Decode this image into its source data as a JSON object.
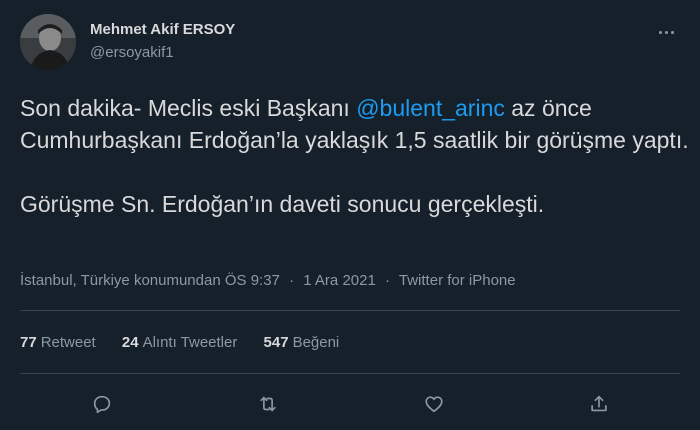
{
  "author": {
    "name": "Mehmet Akif ERSOY",
    "handle": "@ersoyakif1"
  },
  "tweet": {
    "text_part1": "Son dakika- Meclis eski Başkanı ",
    "mention": "@bulent_arinc",
    "text_part2": " az önce Cumhurbaşkanı Erdoğan’la yaklaşık 1,5 saatlik bir görüşme yaptı.",
    "text_line2": "Görüşme Sn. Erdoğan’ın daveti sonucu gerçekleşti."
  },
  "meta": {
    "location": "İstanbul, Türkiye konumundan",
    "time": "ÖS 9:37",
    "separator": "·",
    "date": "1 Ara 2021",
    "source": "Twitter for iPhone"
  },
  "stats": {
    "retweets_count": "77",
    "retweets_label": "Retweet",
    "quotes_count": "24",
    "quotes_label": "Alıntı Tweetler",
    "likes_count": "547",
    "likes_label": "Beğeni"
  },
  "icons": {
    "reply": "reply-icon",
    "retweet": "retweet-icon",
    "like": "heart-icon",
    "share": "share-icon",
    "more": "more-icon"
  },
  "colors": {
    "background": "#15202b",
    "text": "#d9d9d9",
    "secondary": "#8b98a5",
    "accent": "#1d9bf0",
    "divider": "#38444d"
  }
}
